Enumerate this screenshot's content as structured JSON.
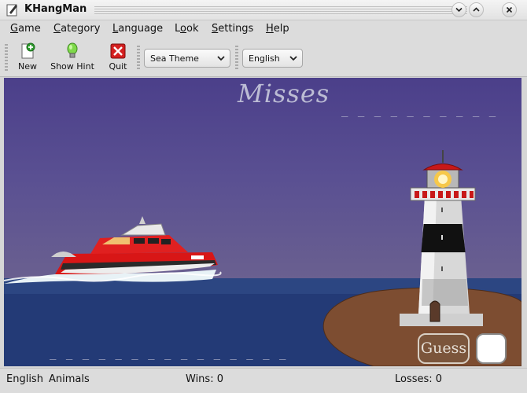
{
  "window": {
    "title": "KHangMan"
  },
  "menu": [
    {
      "pre": "",
      "mnemonic": "G",
      "post": "ame"
    },
    {
      "pre": "",
      "mnemonic": "C",
      "post": "ategory"
    },
    {
      "pre": "",
      "mnemonic": "L",
      "post": "anguage"
    },
    {
      "pre": "L",
      "mnemonic": "o",
      "post": "ok"
    },
    {
      "pre": "",
      "mnemonic": "S",
      "post": "ettings"
    },
    {
      "pre": "",
      "mnemonic": "H",
      "post": "elp"
    }
  ],
  "toolbar": {
    "new_label": "New",
    "hint_label": "Show Hint",
    "quit_label": "Quit",
    "theme_value": "Sea Theme",
    "language_value": "English"
  },
  "game": {
    "misses_label": "Misses",
    "misses_slots": "_ _ _ _ _ _ _ _ _ _",
    "word_slots": "_ _ _ _ _ _ _ _ _ _ _ _ _ _ _",
    "guess_label": "Guess",
    "guess_value": ""
  },
  "status": {
    "language": "English",
    "category": "Animals",
    "wins": "Wins: 0",
    "losses": "Losses: 0"
  }
}
